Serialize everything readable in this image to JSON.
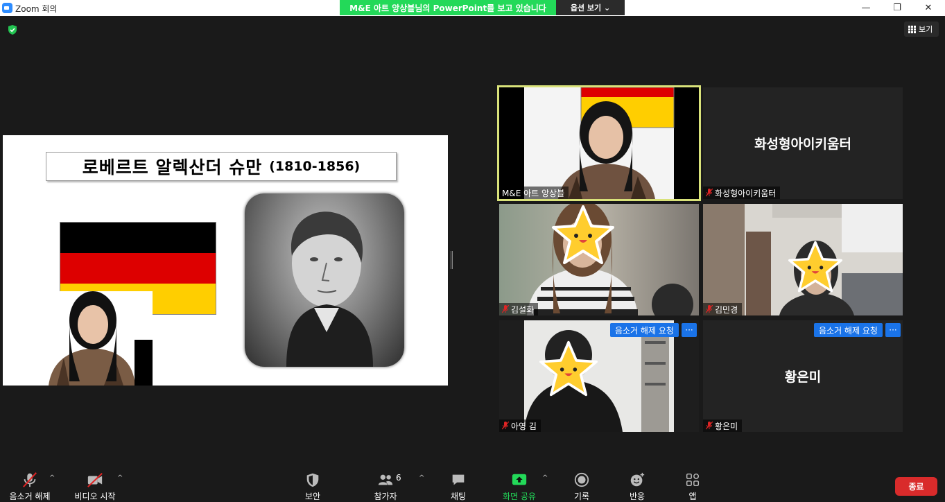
{
  "window": {
    "title": "Zoom 회의",
    "minimize": "—",
    "restore": "❐",
    "close": "✕"
  },
  "banner": {
    "text": "M&E 아트 앙상블님의 PowerPoint를 보고 있습니다",
    "options": "옵션 보기 ⌄"
  },
  "view_button": {
    "label": "보기"
  },
  "slide": {
    "title": "로베르트 알렉산더 슈만",
    "years": "(1810-1856)"
  },
  "participants": [
    {
      "name": "M&E 아트 앙상블",
      "type": "video",
      "active_speaker": true
    },
    {
      "name": "화성형아이키움터",
      "type": "name",
      "muted": true
    },
    {
      "name": "김설화",
      "type": "video",
      "muted": true
    },
    {
      "name": "김민경",
      "type": "video",
      "muted": true
    },
    {
      "name": "아영 김",
      "type": "video",
      "muted": true,
      "unmute_request": "음소거 해제 요청",
      "more": "···"
    },
    {
      "name": "황은미",
      "type": "name",
      "muted": true,
      "unmute_request": "음소거 해제 요청",
      "more": "···"
    }
  ],
  "toolbar": {
    "unmute": "음소거 해제",
    "start_video": "비디오 시작",
    "security": "보안",
    "participants": "참가자",
    "participants_count": "6",
    "chat": "채팅",
    "share": "화면 공유",
    "record": "기록",
    "reactions": "반응",
    "apps": "앱",
    "end": "종료",
    "caret": "^"
  },
  "colors": {
    "share_green": "#23d959",
    "end_red": "#d92b2b",
    "speaker_border": "#d9e27a",
    "request_blue": "#1a73e8"
  }
}
